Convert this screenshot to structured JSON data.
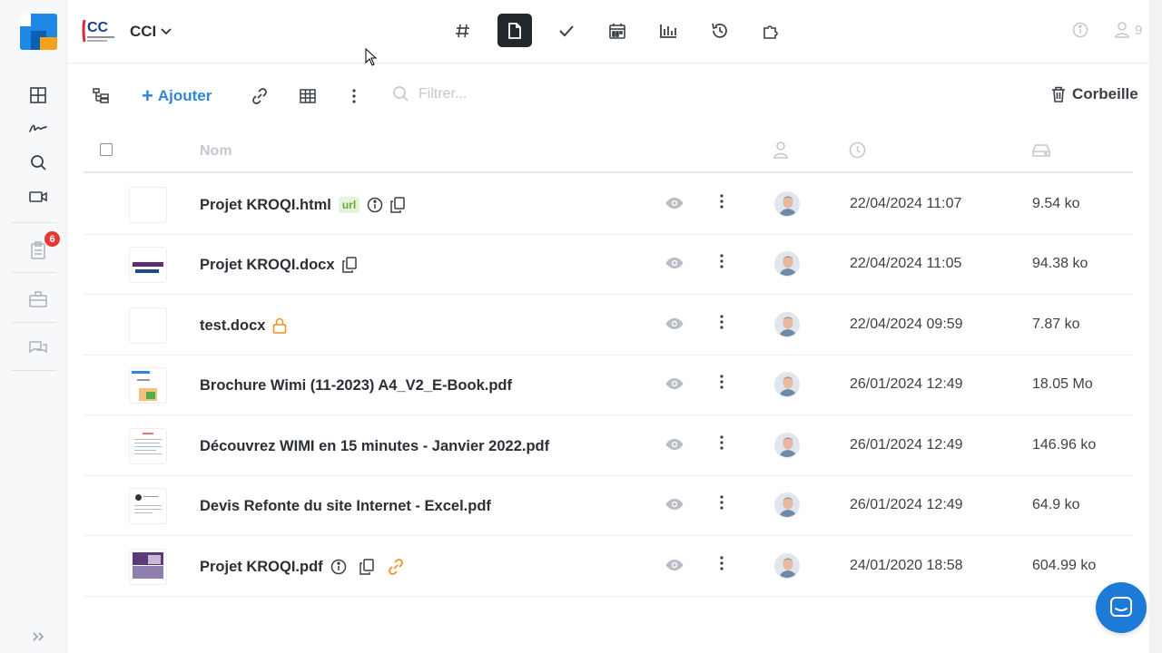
{
  "sidebar": {
    "notification_count": "6",
    "icons": [
      "dashboard-icon",
      "signature-icon",
      "search-icon",
      "video-icon",
      "tasks-icon",
      "briefcase-icon",
      "chat-icon"
    ]
  },
  "header": {
    "org_logo_text": "CC",
    "org_name": "CCI",
    "nav": [
      "hashtag-icon",
      "documents-icon",
      "check-icon",
      "calendar-icon",
      "stats-icon",
      "history-icon",
      "apps-icon"
    ],
    "active_nav": "documents-icon",
    "user_count": "9"
  },
  "toolbar": {
    "add_label": "Ajouter",
    "filter_placeholder": "Filtrer...",
    "trash_label": "Corbeille"
  },
  "table": {
    "name_header": "Nom",
    "rows": [
      {
        "name": "Projet KROQI.html",
        "tag": "url",
        "date": "22/04/2024 11:07",
        "size": "9.54 ko"
      },
      {
        "name": "Projet KROQI.docx",
        "date": "22/04/2024 11:05",
        "size": "94.38 ko"
      },
      {
        "name": "test.docx",
        "date": "22/04/2024 09:59",
        "size": "7.87 ko"
      },
      {
        "name": "Brochure Wimi (11-2023) A4_V2_E-Book.pdf",
        "date": "26/01/2024 12:49",
        "size": "18.05 Mo"
      },
      {
        "name": "Découvrez WIMI en 15 minutes - Janvier 2022.pdf",
        "date": "26/01/2024 12:49",
        "size": "146.96 ko"
      },
      {
        "name": "Devis Refonte du site Internet - Excel.pdf",
        "date": "26/01/2024 12:49",
        "size": "64.9 ko"
      },
      {
        "name": "Projet KROQI.pdf",
        "date": "24/01/2020 18:58",
        "size": "604.99 ko"
      }
    ]
  },
  "colors": {
    "accent": "#2f86d8",
    "active_nav_bg": "#23272e",
    "badge": "#e53935",
    "url_tag_bg": "#e6f4dc",
    "url_tag_text": "#5fa838",
    "warning_icon": "#f0912c",
    "chat_button": "#1d7ad6"
  }
}
